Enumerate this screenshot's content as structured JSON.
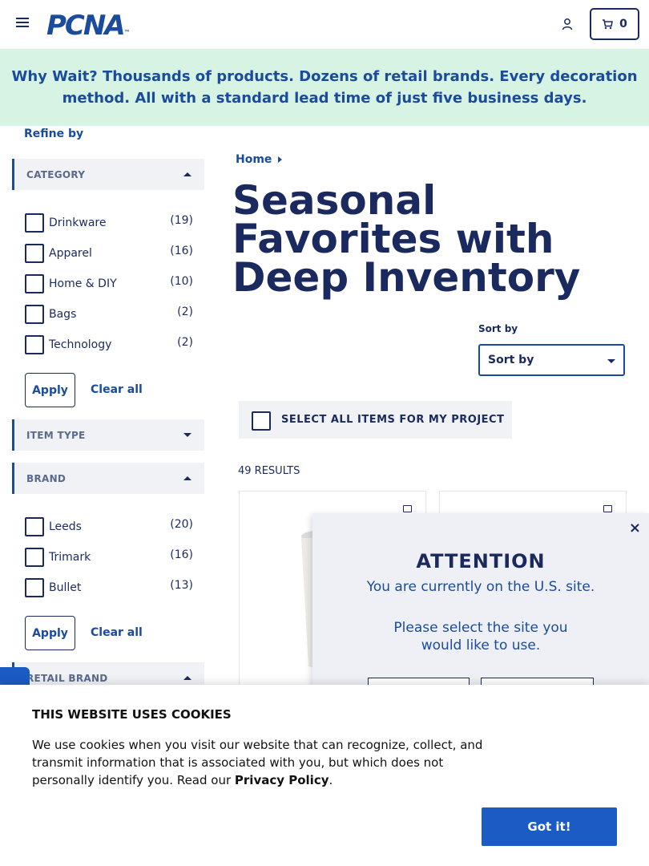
{
  "header": {
    "logo_text": "PCNA",
    "logo_tm": "™",
    "cart_count": "0"
  },
  "banner": {
    "lead": "Why Wait?",
    "text": " Thousands of products. Dozens of retail brands. Every decoration method. All with a standard lead time of just five business days."
  },
  "sidebar": {
    "refine_label": "Refine by",
    "category": {
      "title": "CATEGORY",
      "options": [
        {
          "label": "Drinkware",
          "count": "(19)"
        },
        {
          "label": "Apparel",
          "count": "(16)"
        },
        {
          "label": "Home & DIY",
          "count": "(10)"
        },
        {
          "label": "Bags",
          "count": "(2)"
        },
        {
          "label": "Technology",
          "count": "(2)"
        }
      ],
      "apply": "Apply",
      "clear": "Clear all"
    },
    "item_type": {
      "title": "ITEM TYPE"
    },
    "brand": {
      "title": "BRAND",
      "options": [
        {
          "label": "Leeds",
          "count": "(20)"
        },
        {
          "label": "Trimark",
          "count": "(16)"
        },
        {
          "label": "Bullet",
          "count": "(13)"
        }
      ],
      "apply": "Apply",
      "clear": "Clear all"
    },
    "retail_brand": {
      "title": "RETAIL BRAND"
    }
  },
  "main": {
    "breadcrumb_home": "Home",
    "title": "Seasonal Favorites with Deep Inventory",
    "sort_label": "Sort by",
    "sort_value": "Sort by",
    "select_all": "SELECT ALL ITEMS FOR MY PROJECT",
    "results": "49 RESULTS"
  },
  "site_popup": {
    "close": "×",
    "title": "ATTENTION",
    "line1": "You are currently on the U.S. site.",
    "line2": "Please select the site you would like to use."
  },
  "cookie": {
    "title": "THIS WEBSITE USES COOKIES",
    "text": "We use cookies when you visit our website that can recognize, collect, and transmit information that is associated with you, but which does not personally identify you. Read our ",
    "link": "Privacy Policy",
    "end": ".",
    "button": "Got it!"
  },
  "colors": {
    "brand_blue": "#1a4b9c",
    "navy": "#1b2a5e",
    "banner_bg": "#d6f3e3",
    "button_blue": "#1a5bc4"
  }
}
